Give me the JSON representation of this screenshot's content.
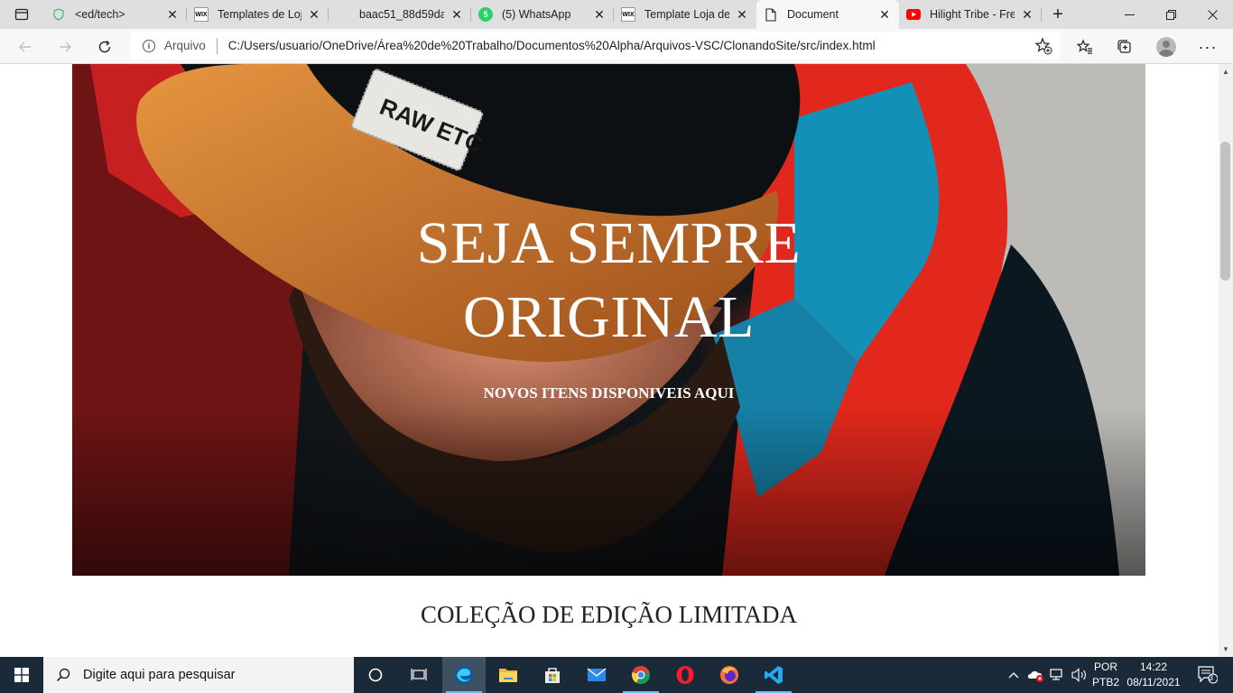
{
  "browser": {
    "tabs": [
      {
        "title": "<ed/tech>",
        "icon": "shield-icon"
      },
      {
        "title": "Templates de Loja",
        "icon": "wix-icon"
      },
      {
        "title": "baac51_88d59da",
        "icon": "blank-icon"
      },
      {
        "title": "(5) WhatsApp",
        "icon": "whatsapp-icon"
      },
      {
        "title": "Template Loja de",
        "icon": "wix-icon"
      },
      {
        "title": "Document",
        "icon": "document-icon"
      },
      {
        "title": "Hilight Tribe - Fre",
        "icon": "youtube-icon"
      }
    ],
    "address": {
      "origin_label": "Arquivo",
      "url": "C:/Users/usuario/OneDrive/Área%20de%20Trabalho/Documentos%20Alpha/Arquivos-VSC/ClonandoSite/src/index.html"
    }
  },
  "page": {
    "hero": {
      "title_line1": "SEJA SEMPRE",
      "title_line2": "ORIGINAL",
      "subtitle": "NOVOS ITENS DISPONIVEIS AQUI",
      "image_caption": "RAW ETC"
    },
    "section_title": "COLEÇÃO DE EDIÇÃO LIMITADA"
  },
  "taskbar": {
    "search_placeholder": "Digite aqui para pesquisar",
    "language": "POR",
    "keyboard": "PTB2",
    "time": "14:22",
    "date": "08/11/2021",
    "notifications": "3"
  },
  "colors": {
    "taskbar": "#1b2a39",
    "tabstrip": "#dfdfdf",
    "toolbar": "#f7f7f7",
    "edge_blue": "#0c59a4",
    "whatsapp_green": "#25d366",
    "youtube_red": "#ff0000"
  }
}
